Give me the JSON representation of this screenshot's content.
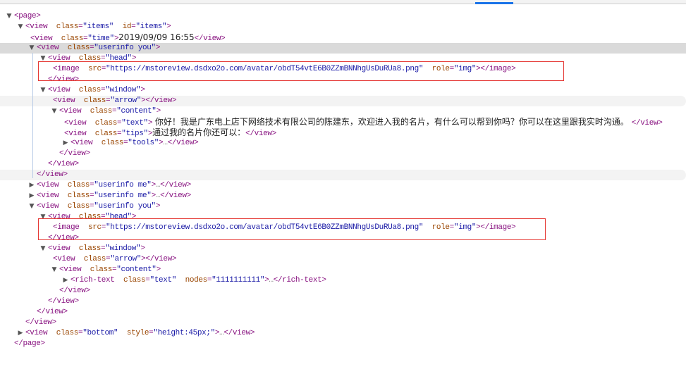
{
  "colors": {
    "tag": "#881280",
    "attr": "#994500",
    "value": "#1a1aa6",
    "highlight": "#e53935",
    "tab_indicator": "#1a73e8"
  },
  "lines": [
    {
      "depth": 0,
      "toggle": "open",
      "tokens": [
        [
          "t",
          "<page>"
        ]
      ]
    },
    {
      "depth": 1,
      "toggle": "open",
      "tokens": [
        [
          "t",
          "<view "
        ],
        [
          "a",
          " class"
        ],
        [
          "t",
          "="
        ],
        [
          "v",
          "\"items\""
        ],
        [
          "a",
          "  id"
        ],
        [
          "t",
          "="
        ],
        [
          "v",
          "\"items\""
        ],
        [
          "t",
          ">"
        ]
      ]
    },
    {
      "depth": 2,
      "toggle": "none",
      "tokens": [
        [
          "t",
          "<view "
        ],
        [
          "a",
          " class"
        ],
        [
          "t",
          "="
        ],
        [
          "v",
          "\"time\""
        ],
        [
          "t",
          ">"
        ],
        [
          "x",
          "2019/09/09 16:55"
        ],
        [
          "t",
          "</view>"
        ]
      ]
    },
    {
      "depth": 2,
      "toggle": "open",
      "state": "sel",
      "tokens": [
        [
          "t",
          "<view "
        ],
        [
          "a",
          " class"
        ],
        [
          "t",
          "="
        ],
        [
          "v",
          "\"userinfo you\""
        ],
        [
          "t",
          ">"
        ]
      ]
    },
    {
      "depth": 3,
      "toggle": "open",
      "tokens": [
        [
          "t",
          "<view "
        ],
        [
          "a",
          " class"
        ],
        [
          "t",
          "="
        ],
        [
          "v",
          "\"head\""
        ],
        [
          "t",
          ">"
        ]
      ]
    },
    {
      "depth": 4,
      "toggle": "none",
      "tokens": [
        [
          "t",
          "<image "
        ],
        [
          "a",
          " src"
        ],
        [
          "t",
          "="
        ],
        [
          "v",
          "\"https://mstoreview.dsdxo2o.com/avatar/obdT54vtE6B0ZZmBNNhgUsDuRUa8.png\""
        ],
        [
          "a",
          "  role"
        ],
        [
          "t",
          "="
        ],
        [
          "v",
          "\"img\""
        ],
        [
          "t",
          "></image>"
        ]
      ]
    },
    {
      "depth": 3,
      "toggle": "close",
      "tokens": [
        [
          "t",
          "</view>"
        ]
      ]
    },
    {
      "depth": 3,
      "toggle": "open",
      "tokens": [
        [
          "t",
          "<view "
        ],
        [
          "a",
          " class"
        ],
        [
          "t",
          "="
        ],
        [
          "v",
          "\"window\""
        ],
        [
          "t",
          ">"
        ]
      ]
    },
    {
      "depth": 4,
      "toggle": "none",
      "state": "hov",
      "tokens": [
        [
          "t",
          "<view "
        ],
        [
          "a",
          " class"
        ],
        [
          "t",
          "="
        ],
        [
          "v",
          "\"arrow\""
        ],
        [
          "t",
          "></view>"
        ]
      ]
    },
    {
      "depth": 4,
      "toggle": "open",
      "tokens": [
        [
          "t",
          "<view "
        ],
        [
          "a",
          " class"
        ],
        [
          "t",
          "="
        ],
        [
          "v",
          "\"content\""
        ],
        [
          "t",
          ">"
        ]
      ]
    },
    {
      "depth": 5,
      "toggle": "none",
      "tokens": [
        [
          "t",
          "<view "
        ],
        [
          "a",
          " class"
        ],
        [
          "t",
          "="
        ],
        [
          "v",
          "\"text\""
        ],
        [
          "t",
          ">"
        ],
        [
          "x",
          " 你好！我是广东电上店下网络技术有限公司的陈建东，欢迎进入我的名片，有什么可以帮到你吗？你可以在这里跟我实时沟通。 "
        ],
        [
          "t",
          "</view>"
        ]
      ]
    },
    {
      "depth": 5,
      "toggle": "none",
      "tokens": [
        [
          "t",
          "<view "
        ],
        [
          "a",
          " class"
        ],
        [
          "t",
          "="
        ],
        [
          "v",
          "\"tips\""
        ],
        [
          "t",
          ">"
        ],
        [
          "x",
          "通过我的名片你还可以："
        ],
        [
          "t",
          "</view>"
        ]
      ]
    },
    {
      "depth": 5,
      "toggle": "closed",
      "tokens": [
        [
          "t",
          "<view "
        ],
        [
          "a",
          " class"
        ],
        [
          "t",
          "="
        ],
        [
          "v",
          "\"tools\""
        ],
        [
          "t",
          ">"
        ],
        [
          "e",
          "…"
        ],
        [
          "t",
          "</view>"
        ]
      ]
    },
    {
      "depth": 4,
      "toggle": "close",
      "tokens": [
        [
          "t",
          "</view>"
        ]
      ]
    },
    {
      "depth": 3,
      "toggle": "close",
      "tokens": [
        [
          "t",
          "</view>"
        ]
      ]
    },
    {
      "depth": 2,
      "toggle": "close",
      "state": "hov",
      "tokens": [
        [
          "t",
          "</view>"
        ]
      ]
    },
    {
      "depth": 2,
      "toggle": "closed",
      "tokens": [
        [
          "t",
          "<view "
        ],
        [
          "a",
          " class"
        ],
        [
          "t",
          "="
        ],
        [
          "v",
          "\"userinfo me\""
        ],
        [
          "t",
          ">"
        ],
        [
          "e",
          "…"
        ],
        [
          "t",
          "</view>"
        ]
      ]
    },
    {
      "depth": 2,
      "toggle": "closed",
      "tokens": [
        [
          "t",
          "<view "
        ],
        [
          "a",
          " class"
        ],
        [
          "t",
          "="
        ],
        [
          "v",
          "\"userinfo me\""
        ],
        [
          "t",
          ">"
        ],
        [
          "e",
          "…"
        ],
        [
          "t",
          "</view>"
        ]
      ]
    },
    {
      "depth": 2,
      "toggle": "open",
      "tokens": [
        [
          "t",
          "<view "
        ],
        [
          "a",
          " class"
        ],
        [
          "t",
          "="
        ],
        [
          "v",
          "\"userinfo you\""
        ],
        [
          "t",
          ">"
        ]
      ]
    },
    {
      "depth": 3,
      "toggle": "open",
      "tokens": [
        [
          "t",
          "<view "
        ],
        [
          "a",
          " class"
        ],
        [
          "t",
          "="
        ],
        [
          "v",
          "\"head\""
        ],
        [
          "t",
          ">"
        ]
      ]
    },
    {
      "depth": 4,
      "toggle": "none",
      "tokens": [
        [
          "t",
          "<image "
        ],
        [
          "a",
          " src"
        ],
        [
          "t",
          "="
        ],
        [
          "v",
          "\"https://mstoreview.dsdxo2o.com/avatar/obdT54vtE6B0ZZmBNNhgUsDuRUa8.png\""
        ],
        [
          "a",
          "  role"
        ],
        [
          "t",
          "="
        ],
        [
          "v",
          "\"img\""
        ],
        [
          "t",
          "></image>"
        ]
      ]
    },
    {
      "depth": 3,
      "toggle": "close",
      "tokens": [
        [
          "t",
          "</view>"
        ]
      ]
    },
    {
      "depth": 3,
      "toggle": "open",
      "tokens": [
        [
          "t",
          "<view "
        ],
        [
          "a",
          " class"
        ],
        [
          "t",
          "="
        ],
        [
          "v",
          "\"window\""
        ],
        [
          "t",
          ">"
        ]
      ]
    },
    {
      "depth": 4,
      "toggle": "none",
      "tokens": [
        [
          "t",
          "<view "
        ],
        [
          "a",
          " class"
        ],
        [
          "t",
          "="
        ],
        [
          "v",
          "\"arrow\""
        ],
        [
          "t",
          "></view>"
        ]
      ]
    },
    {
      "depth": 4,
      "toggle": "open",
      "tokens": [
        [
          "t",
          "<view "
        ],
        [
          "a",
          " class"
        ],
        [
          "t",
          "="
        ],
        [
          "v",
          "\"content\""
        ],
        [
          "t",
          ">"
        ]
      ]
    },
    {
      "depth": 5,
      "toggle": "closed",
      "tokens": [
        [
          "t",
          "<rich-text "
        ],
        [
          "a",
          " class"
        ],
        [
          "t",
          "="
        ],
        [
          "v",
          "\"text\""
        ],
        [
          "a",
          "  nodes"
        ],
        [
          "t",
          "="
        ],
        [
          "v",
          "\"1111111111\""
        ],
        [
          "t",
          ">"
        ],
        [
          "e",
          "…"
        ],
        [
          "t",
          "</rich-text>"
        ]
      ]
    },
    {
      "depth": 4,
      "toggle": "close",
      "tokens": [
        [
          "t",
          "</view>"
        ]
      ]
    },
    {
      "depth": 3,
      "toggle": "close",
      "tokens": [
        [
          "t",
          "</view>"
        ]
      ]
    },
    {
      "depth": 2,
      "toggle": "close",
      "tokens": [
        [
          "t",
          "</view>"
        ]
      ]
    },
    {
      "depth": 1,
      "toggle": "close",
      "tokens": [
        [
          "t",
          "</view>"
        ]
      ]
    },
    {
      "depth": 1,
      "toggle": "closed",
      "tokens": [
        [
          "t",
          "<view "
        ],
        [
          "a",
          " class"
        ],
        [
          "t",
          "="
        ],
        [
          "v",
          "\"bottom\""
        ],
        [
          "a",
          "  style"
        ],
        [
          "t",
          "="
        ],
        [
          "v",
          "\"height:45px;\""
        ],
        [
          "t",
          ">"
        ],
        [
          "e",
          "…"
        ],
        [
          "t",
          "</view>"
        ]
      ]
    },
    {
      "depth": 0,
      "toggle": "close",
      "tokens": [
        [
          "t",
          "</page>"
        ]
      ]
    }
  ]
}
